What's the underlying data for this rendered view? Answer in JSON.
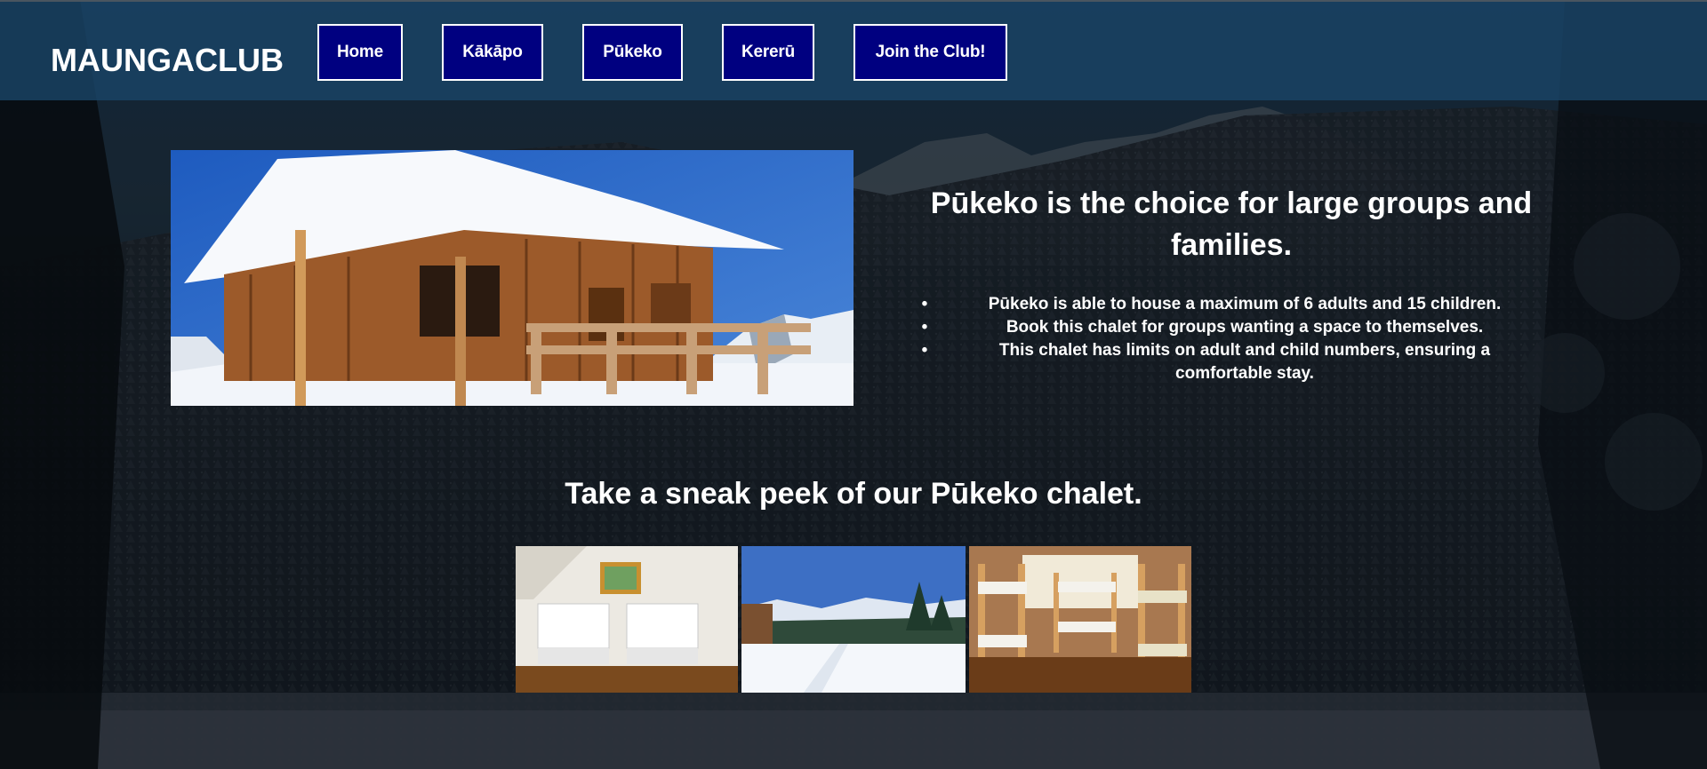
{
  "header": {
    "logo_text": "MAUNGACLUB",
    "nav": [
      {
        "label": "Home"
      },
      {
        "label": "Kākāpo"
      },
      {
        "label": "Pūkeko"
      },
      {
        "label": "Kererū"
      },
      {
        "label": "Join the Club!"
      }
    ]
  },
  "hero": {
    "image_label": "snow-covered wooden chalet",
    "headline": "Pūkeko is the choice for large groups and families.",
    "features": [
      {
        "text": "Pūkeko is able to house a maximum of 6 adults and 15 children."
      },
      {
        "text": "Book this chalet for groups wanting a space to themselves."
      },
      {
        "text": "This chalet has limits on adult and child numbers, ensuring a comfortable stay."
      }
    ]
  },
  "gallery": {
    "title": "Take a sneak peek of our Pūkeko chalet.",
    "images": [
      {
        "label": "twin bedroom"
      },
      {
        "label": "snowy mountain view"
      },
      {
        "label": "bunk bed room"
      }
    ]
  },
  "colors": {
    "nav_button_bg": "#000080",
    "nav_button_border": "#ffffff",
    "topbar_bg": "#1a4466",
    "text": "#ffffff"
  }
}
